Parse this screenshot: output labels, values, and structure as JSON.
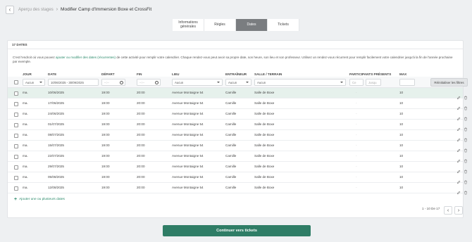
{
  "breadcrumb": {
    "parent": "Aperçu des stages",
    "current": "Modifier Camp d'Immersion Boxe et CrossFit"
  },
  "tabs": [
    {
      "label": "Informations\ngénérales"
    },
    {
      "label": "Règles"
    },
    {
      "label": "Dates"
    },
    {
      "label": "Tickets"
    }
  ],
  "card": {
    "title": "17 DATES",
    "desc_before": "C'est l'endroit où vous pouvez ",
    "desc_link": "ajouter ou modifier des dates (récurrentes)",
    "desc_after": " de cette activité pour remplir votre calendrier. Chaque rendez-vous peut avoir sa propre date, son heure, son lieu et son professeur. Utilisez un rendez-vous récurrent pour remplir facilement votre calendrier jusqu'à la fin de l'année prochaine par exemple."
  },
  "columns": {
    "day": "JOUR",
    "date": "DATE",
    "start": "DÉPART",
    "end": "FIN",
    "place": "LIEU",
    "coach": "ENTRAÎNEUR",
    "room": "SALLE / TERRAIN",
    "participants": "PARTICIPANTS PRÉSENTS",
    "max": "MAX"
  },
  "filters": {
    "day": "Aucun",
    "date_range": "10/06/2025 - 30/09/2025",
    "start_placeholder": "--:--",
    "end_placeholder": "--:--",
    "place": "Aucun",
    "coach": "Aucun",
    "room": "Aucun",
    "participants_from": "Ce",
    "participants_to": "Jusqu",
    "reset_label": "Réinitialiser les filtres"
  },
  "rows": [
    {
      "day": "ma.",
      "date": "10/06/2025",
      "start": "19:00",
      "end": "20:00",
      "place": "Avenue Montaigne 54",
      "coach": "Camille",
      "room": "Salle de Boxe",
      "participants": "-",
      "max": "10"
    },
    {
      "day": "ma.",
      "date": "17/06/2025",
      "start": "19:00",
      "end": "20:00",
      "place": "Avenue Montaigne 54",
      "coach": "Camille",
      "room": "Salle de Boxe",
      "participants": "-",
      "max": "10"
    },
    {
      "day": "ma.",
      "date": "24/06/2025",
      "start": "19:00",
      "end": "20:00",
      "place": "Avenue Montaigne 54",
      "coach": "Camille",
      "room": "Salle de Boxe",
      "participants": "-",
      "max": "10"
    },
    {
      "day": "ma.",
      "date": "01/07/2025",
      "start": "19:00",
      "end": "20:00",
      "place": "Avenue Montaigne 54",
      "coach": "Camille",
      "room": "Salle de Boxe",
      "participants": "-",
      "max": "10"
    },
    {
      "day": "ma.",
      "date": "08/07/2025",
      "start": "19:00",
      "end": "20:00",
      "place": "Avenue Montaigne 54",
      "coach": "Camille",
      "room": "Salle de Boxe",
      "participants": "-",
      "max": "10"
    },
    {
      "day": "ma.",
      "date": "15/07/2025",
      "start": "19:00",
      "end": "20:00",
      "place": "Avenue Montaigne 54",
      "coach": "Camille",
      "room": "Salle de Boxe",
      "participants": "-",
      "max": "10"
    },
    {
      "day": "ma.",
      "date": "22/07/2025",
      "start": "19:00",
      "end": "20:00",
      "place": "Avenue Montaigne 54",
      "coach": "Camille",
      "room": "Salle de Boxe",
      "participants": "-",
      "max": "10"
    },
    {
      "day": "ma.",
      "date": "29/07/2025",
      "start": "19:00",
      "end": "20:00",
      "place": "Avenue Montaigne 54",
      "coach": "Camille",
      "room": "Salle de Boxe",
      "participants": "-",
      "max": "10"
    },
    {
      "day": "ma.",
      "date": "05/08/2025",
      "start": "19:00",
      "end": "20:00",
      "place": "Avenue Montaigne 54",
      "coach": "Camille",
      "room": "Salle de Boxe",
      "participants": "-",
      "max": "10"
    },
    {
      "day": "ma.",
      "date": "12/08/2025",
      "start": "19:00",
      "end": "20:00",
      "place": "Avenue Montaigne 54",
      "coach": "Camille",
      "room": "Salle de Boxe",
      "participants": "-",
      "max": "10"
    }
  ],
  "add_dates_label": "Ajouter une ou plusieurs dates",
  "pagination": {
    "label": "1 - 10 De 17"
  },
  "cta_label": "Continuer vers tickets",
  "colors": {
    "accent": "#2f7d66",
    "link": "#2a8a6a",
    "active_tab": "#7a7d80",
    "selected_row": "#e6f1ec"
  }
}
